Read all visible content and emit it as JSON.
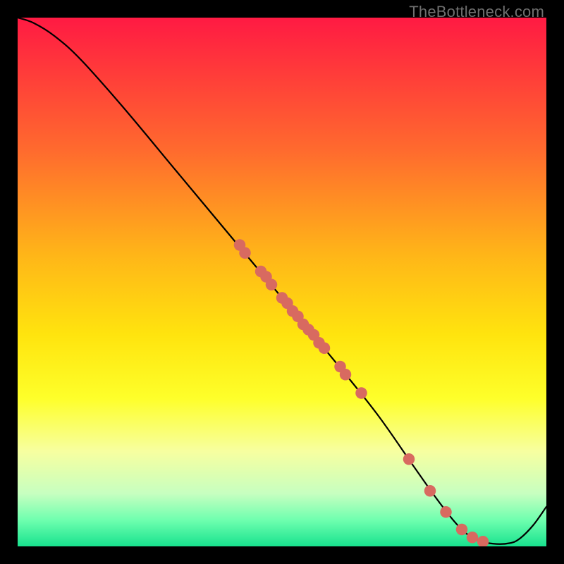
{
  "chart_data": {
    "type": "line",
    "watermark": "TheBottleneck.com",
    "xlim": [
      0,
      100
    ],
    "ylim": [
      0,
      100
    ],
    "gradient_stops": [
      {
        "offset": 0.0,
        "color": "#ff1a43"
      },
      {
        "offset": 0.1,
        "color": "#ff3a3a"
      },
      {
        "offset": 0.25,
        "color": "#ff6a2e"
      },
      {
        "offset": 0.45,
        "color": "#ffb618"
      },
      {
        "offset": 0.6,
        "color": "#ffe40e"
      },
      {
        "offset": 0.72,
        "color": "#feff2a"
      },
      {
        "offset": 0.82,
        "color": "#f7ffa0"
      },
      {
        "offset": 0.9,
        "color": "#c7ffc0"
      },
      {
        "offset": 0.95,
        "color": "#6fffaf"
      },
      {
        "offset": 1.0,
        "color": "#18e28e"
      }
    ],
    "curve": [
      {
        "x": 0,
        "y": 100
      },
      {
        "x": 3,
        "y": 99
      },
      {
        "x": 7,
        "y": 96.5
      },
      {
        "x": 12,
        "y": 92
      },
      {
        "x": 20,
        "y": 83
      },
      {
        "x": 30,
        "y": 71
      },
      {
        "x": 40,
        "y": 59
      },
      {
        "x": 50,
        "y": 47
      },
      {
        "x": 60,
        "y": 35
      },
      {
        "x": 68,
        "y": 25
      },
      {
        "x": 75,
        "y": 15
      },
      {
        "x": 80,
        "y": 8
      },
      {
        "x": 84,
        "y": 3.2
      },
      {
        "x": 87,
        "y": 1.2
      },
      {
        "x": 90,
        "y": 0.5
      },
      {
        "x": 93,
        "y": 0.6
      },
      {
        "x": 95,
        "y": 1.5
      },
      {
        "x": 97.5,
        "y": 4
      },
      {
        "x": 100,
        "y": 7.5
      }
    ],
    "points": [
      {
        "x": 42,
        "y": 57
      },
      {
        "x": 43,
        "y": 55.5
      },
      {
        "x": 46,
        "y": 52
      },
      {
        "x": 47,
        "y": 51
      },
      {
        "x": 48,
        "y": 49.5
      },
      {
        "x": 50,
        "y": 47
      },
      {
        "x": 51,
        "y": 46
      },
      {
        "x": 52,
        "y": 44.5
      },
      {
        "x": 53,
        "y": 43.5
      },
      {
        "x": 54,
        "y": 42
      },
      {
        "x": 55,
        "y": 41
      },
      {
        "x": 56,
        "y": 40
      },
      {
        "x": 57,
        "y": 38.5
      },
      {
        "x": 58,
        "y": 37.5
      },
      {
        "x": 61,
        "y": 34
      },
      {
        "x": 62,
        "y": 32.5
      },
      {
        "x": 65,
        "y": 29
      },
      {
        "x": 74,
        "y": 16.5
      },
      {
        "x": 78,
        "y": 10.5
      },
      {
        "x": 81,
        "y": 6.5
      },
      {
        "x": 84,
        "y": 3.2
      },
      {
        "x": 86,
        "y": 1.7
      },
      {
        "x": 88,
        "y": 0.9
      }
    ],
    "point_color": "#d86a60",
    "point_radius_pct": 1.1
  }
}
